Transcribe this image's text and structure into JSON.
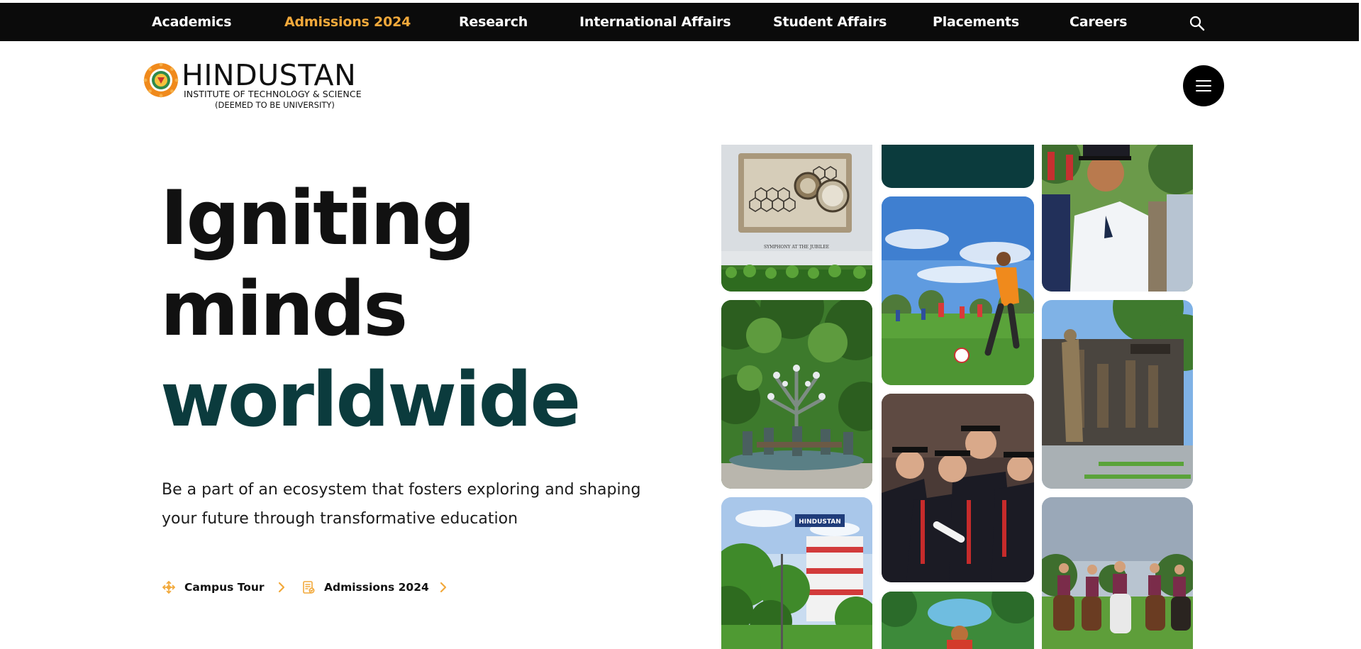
{
  "nav": {
    "items": [
      {
        "label": "Academics"
      },
      {
        "label": "Admissions 2024"
      },
      {
        "label": "Research"
      },
      {
        "label": "International Affairs"
      },
      {
        "label": "Student Affairs"
      },
      {
        "label": "Placements"
      },
      {
        "label": "Careers"
      }
    ],
    "search_icon": "search-icon"
  },
  "logo": {
    "title": "HINDUSTAN",
    "line1": "INSTITUTE OF TECHNOLOGY & SCIENCE",
    "line2": "(DEEMED TO BE UNIVERSITY)"
  },
  "menu_icon": "hamburger-icon",
  "hero": {
    "line1": "Igniting",
    "line2": "minds",
    "line3": "worldwide",
    "description": "Be a part of an ecosystem that fosters exploring and shaping your future through transformative education"
  },
  "ctas": [
    {
      "label": "Campus Tour",
      "icon": "move-icon"
    },
    {
      "label": "Admissions 2024",
      "icon": "document-icon"
    }
  ],
  "gallery": {
    "sculpture_caption": "SYMPHONY AT THE JUBILEE",
    "building_sign": "HINDUSTAN"
  },
  "colors": {
    "nav_bg": "#0b0b0b",
    "nav_active": "#f2a93b",
    "accent_teal": "#0b3b3d",
    "cta_icon": "#f2a93b"
  }
}
